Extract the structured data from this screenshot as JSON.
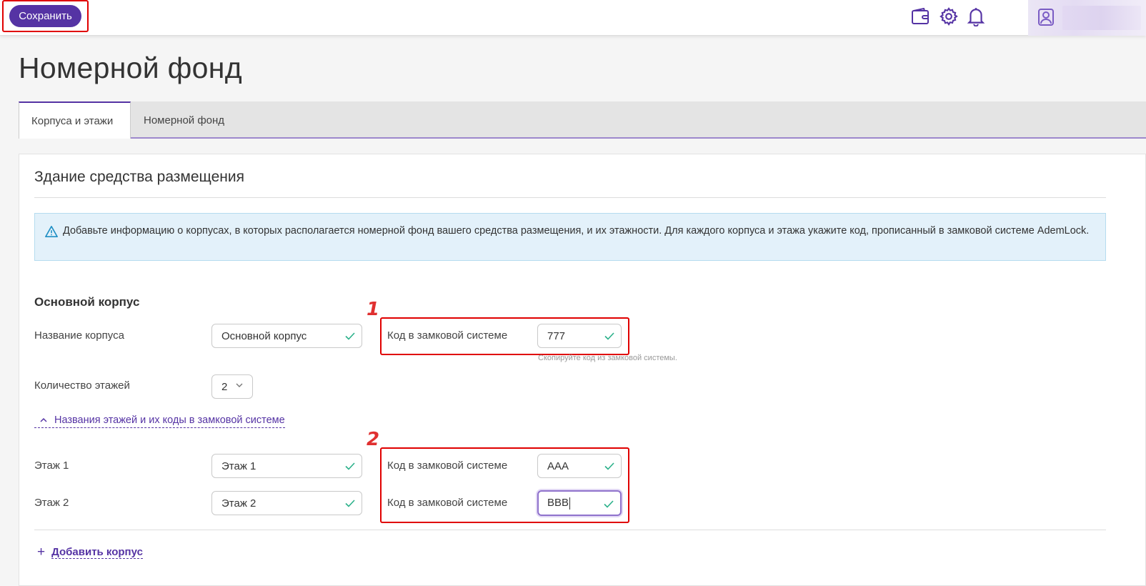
{
  "toolbar": {
    "save_label": "Сохранить"
  },
  "header_icons": [
    "wallet-icon",
    "gear-icon",
    "bell-icon",
    "user-icon"
  ],
  "page": {
    "title": "Номерной фонд"
  },
  "tabs": [
    {
      "label": "Корпуса и этажи",
      "active": true
    },
    {
      "label": "Номерной фонд",
      "active": false
    }
  ],
  "section": {
    "title": "Здание средства размещения",
    "info": "Добавьте информацию о корпусах, в которых располагается номерной фонд вашего средства размещения, и их этажности. Для каждого корпуса и этажа укажите код, прописанный в замковой системе AdemLock."
  },
  "building": {
    "title": "Основной корпус",
    "name_label": "Название корпуса",
    "name_value": "Основной корпус",
    "lock_label": "Код в замковой системе",
    "lock_value": "777",
    "lock_hint": "Скопируйте код из замковой системы.",
    "floors_label": "Количество этажей",
    "floors_value": "2",
    "expander_label": "Названия этажей и их коды в замковой системе"
  },
  "floors": [
    {
      "label": "Этаж 1",
      "name": "Этаж 1",
      "lock_label": "Код в замковой системе",
      "lock_value": "AAA"
    },
    {
      "label": "Этаж 2",
      "name": "Этаж 2",
      "lock_label": "Код в замковой системе",
      "lock_value": "BBB"
    }
  ],
  "annotations": {
    "one": "1",
    "two": "2"
  },
  "actions": {
    "add_building": "Добавить корпус"
  },
  "colors": {
    "accent": "#5533a4",
    "highlight": "#e00000",
    "check": "#2bb18a",
    "info_bg": "#e3f1fa"
  }
}
